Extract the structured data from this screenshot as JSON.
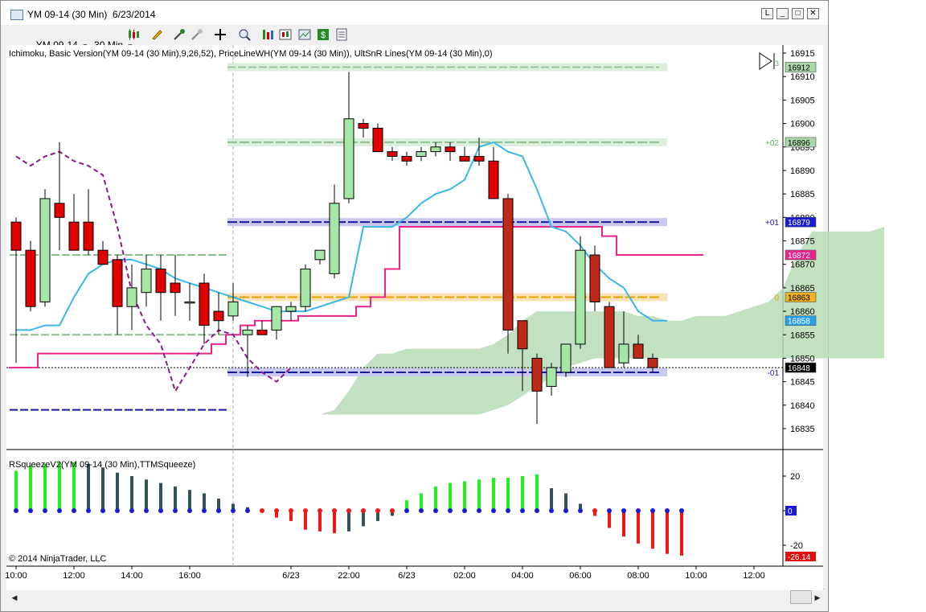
{
  "window": {
    "title": "YM 09-14 (30 Min)  6/23/2014",
    "buttons": [
      "L",
      "□",
      "✕"
    ]
  },
  "toolbar": {
    "instrument": "YM 09-14",
    "interval": "30 Min",
    "icons": [
      "candlestick-icon",
      "pencil-icon",
      "add-indicator-icon",
      "remove-indicator-icon",
      "crosshair-icon",
      "zoom-icon",
      "bar-type-icon",
      "strategy-icon",
      "chart-properties-icon",
      "dollar-icon",
      "data-box-icon"
    ]
  },
  "chart_data": [
    {
      "type": "candlestick",
      "title": "Ichimoku, Basic Version(YM 09-14 (30 Min),9,26,52), PriceLineWH(YM 09-14 (30 Min)), UltSnR Lines(YM 09-14 (30 Min),0)",
      "y_ticks": [
        16835,
        16840,
        16845,
        16850,
        16855,
        16860,
        16865,
        16870,
        16875,
        16880,
        16885,
        16890,
        16895,
        16900,
        16905,
        16910,
        16915
      ],
      "ylim": [
        16831,
        16916
      ],
      "x_ticks": [
        "10:00",
        "12:00",
        "14:00",
        "16:00",
        "6/23",
        "22:00",
        "6/23",
        "02:00",
        "04:00",
        "06:00",
        "08:00",
        "10:00",
        "12:00"
      ],
      "session_break": "6/23 18:00",
      "candles": [
        {
          "o": 16879,
          "h": 16880,
          "l": 16849,
          "c": 16873
        },
        {
          "o": 16873,
          "h": 16875,
          "l": 16860,
          "c": 16861
        },
        {
          "o": 16862,
          "h": 16886,
          "l": 16861,
          "c": 16884
        },
        {
          "o": 16883,
          "h": 16896,
          "l": 16873,
          "c": 16880
        },
        {
          "o": 16879,
          "h": 16885,
          "l": 16873,
          "c": 16873
        },
        {
          "o": 16879,
          "h": 16886,
          "l": 16872,
          "c": 16873
        },
        {
          "o": 16873,
          "h": 16875,
          "l": 16870,
          "c": 16870
        },
        {
          "o": 16871,
          "h": 16872,
          "l": 16855,
          "c": 16861
        },
        {
          "o": 16861,
          "h": 16870,
          "l": 16856,
          "c": 16865
        },
        {
          "o": 16864,
          "h": 16872,
          "l": 16861,
          "c": 16869
        },
        {
          "o": 16869,
          "h": 16872,
          "l": 16858,
          "c": 16864
        },
        {
          "o": 16866,
          "h": 16872,
          "l": 16859,
          "c": 16864
        },
        {
          "o": 16862,
          "h": 16866,
          "l": 16858,
          "c": 16862
        },
        {
          "o": 16866,
          "h": 16868,
          "l": 16853,
          "c": 16857
        },
        {
          "o": 16860,
          "h": 16864,
          "l": 16855,
          "c": 16858
        },
        {
          "o": 16859,
          "h": 16866,
          "l": 16858,
          "c": 16862
        },
        {
          "o": 16855,
          "h": 16857,
          "l": 16846,
          "c": 16856
        },
        {
          "o": 16856,
          "h": 16858,
          "l": 16855,
          "c": 16855
        },
        {
          "o": 16856,
          "h": 16861,
          "l": 16854,
          "c": 16861
        },
        {
          "o": 16860,
          "h": 16862,
          "l": 16858,
          "c": 16861
        },
        {
          "o": 16861,
          "h": 16870,
          "l": 16860,
          "c": 16869
        },
        {
          "o": 16871,
          "h": 16873,
          "l": 16870,
          "c": 16873
        },
        {
          "o": 16868,
          "h": 16887,
          "l": 16867,
          "c": 16883
        },
        {
          "o": 16884,
          "h": 16911,
          "l": 16883,
          "c": 16901
        },
        {
          "o": 16900,
          "h": 16901,
          "l": 16897,
          "c": 16899
        },
        {
          "o": 16899,
          "h": 16900,
          "l": 16895,
          "c": 16894
        },
        {
          "o": 16894,
          "h": 16895,
          "l": 16892,
          "c": 16893
        },
        {
          "o": 16893,
          "h": 16894,
          "l": 16891,
          "c": 16892
        },
        {
          "o": 16893,
          "h": 16895,
          "l": 16892,
          "c": 16894
        },
        {
          "o": 16894,
          "h": 16896,
          "l": 16893,
          "c": 16895
        },
        {
          "o": 16895,
          "h": 16896,
          "l": 16892,
          "c": 16894
        },
        {
          "o": 16893,
          "h": 16895,
          "l": 16892,
          "c": 16892
        },
        {
          "o": 16893,
          "h": 16897,
          "l": 16891,
          "c": 16892
        },
        {
          "o": 16892,
          "h": 16895,
          "l": 16884,
          "c": 16884
        },
        {
          "o": 16884,
          "h": 16885,
          "l": 16851,
          "c": 16856
        },
        {
          "o": 16858,
          "h": 16858,
          "l": 16843,
          "c": 16852
        },
        {
          "o": 16850,
          "h": 16851,
          "l": 16836,
          "c": 16843
        },
        {
          "o": 16844,
          "h": 16849,
          "l": 16842,
          "c": 16848
        },
        {
          "o": 16847,
          "h": 16853,
          "l": 16846,
          "c": 16853
        },
        {
          "o": 16853,
          "h": 16876,
          "l": 16852,
          "c": 16873
        },
        {
          "o": 16872,
          "h": 16874,
          "l": 16860,
          "c": 16862
        },
        {
          "o": 16861,
          "h": 16862,
          "l": 16848,
          "c": 16848
        },
        {
          "o": 16849,
          "h": 16860,
          "l": 16848,
          "c": 16853
        },
        {
          "o": 16853,
          "h": 16855,
          "l": 16850,
          "c": 16850
        },
        {
          "o": 16850,
          "h": 16851,
          "l": 16847,
          "c": 16848
        }
      ],
      "tenkan": [
        16856,
        16856,
        16857,
        16857,
        16863,
        16868,
        16870,
        16871,
        16871,
        16870,
        16869,
        16867,
        16866,
        16865,
        16864,
        16863,
        16862,
        16861,
        16860,
        16860,
        16860,
        16861,
        16862,
        16863,
        16878,
        16878,
        16878,
        16880,
        16883,
        16885,
        16886,
        16888,
        16895,
        16896,
        16894,
        16893,
        16886,
        16878,
        16877,
        16874,
        16870,
        16867,
        16865,
        16860,
        16858,
        16858
      ],
      "kijun": [
        16848,
        16848,
        16851,
        16851,
        16851,
        16851,
        16851,
        16851,
        16851,
        16851,
        16851,
        16851,
        16851,
        16851,
        16853,
        16855,
        16857,
        16858,
        16858,
        16858,
        16859,
        16859,
        16859,
        16859,
        16861,
        16863,
        16869,
        16878,
        16878,
        16878,
        16878,
        16878,
        16878,
        16878,
        16878,
        16878,
        16878,
        16878,
        16878,
        16878,
        16878,
        16876,
        16872,
        16872,
        16872,
        16872,
        16872,
        16872
      ],
      "chikou": [
        16893,
        16891,
        16893,
        16894,
        16892,
        16891,
        16889,
        16878,
        16864,
        16857,
        16853,
        16843,
        16848,
        16853,
        16856,
        16855,
        16850,
        16847,
        16845,
        16848
      ],
      "cloud": {
        "x_start_index": 18,
        "top": [
          16838,
          16838,
          16838,
          16838,
          16839,
          16843,
          16848,
          16851,
          16851,
          16852,
          16852,
          16852,
          16852,
          16852,
          16852,
          16853,
          16855,
          16858,
          16860,
          16860,
          16860,
          16860,
          16860,
          16860,
          16860,
          16859,
          16859,
          16858,
          16858,
          16859,
          16859,
          16859,
          16860,
          16861,
          16862,
          16865,
          16872,
          16877,
          16877,
          16877,
          16877,
          16877,
          16878
        ],
        "bottom": [
          16838,
          16838,
          16838,
          16838,
          16838,
          16838,
          16838,
          16838,
          16838,
          16838,
          16838,
          16838,
          16838,
          16838,
          16838,
          16839,
          16840,
          16842,
          16844,
          16846,
          16848,
          16849,
          16850,
          16850,
          16850,
          16850,
          16850,
          16850,
          16850,
          16850,
          16850,
          16850,
          16850,
          16850,
          16850,
          16850,
          16850,
          16850,
          16850,
          16850,
          16850,
          16850,
          16850
        ]
      },
      "levels_prior": [
        {
          "name": "resistance",
          "value": 16872,
          "color": "#8fbc8f",
          "dashed": true
        },
        {
          "name": "support",
          "value": 16855,
          "color": "#8fbc8f",
          "dashed": true
        },
        {
          "name": "s2",
          "value": 16839,
          "color": "#1a1aa0",
          "dashed": true
        }
      ],
      "levels_current": [
        {
          "label": "+02",
          "value": 16896,
          "color": "#8fbc8f",
          "badge": "16896",
          "text_color": "#66aa66"
        },
        {
          "label": "+01",
          "value": 16879,
          "color": "#1a1aa0",
          "badge": "16879",
          "text_color": "#1a1aa0"
        },
        {
          "label": "0",
          "value": 16863,
          "color": "#e8a000",
          "badge": "16863",
          "text_color": "#e8a000"
        },
        {
          "label": "-01",
          "value": 16847,
          "color": "#1a1aa0",
          "badge": "16848",
          "text_color": "#1a1aa0"
        }
      ],
      "top_level": {
        "label": "+3",
        "value": 16912,
        "badge": "16912"
      },
      "axis_badges": [
        {
          "value": 16912,
          "text": "16912",
          "bg": "#a8d8a8",
          "fg": "#000"
        },
        {
          "value": 16896,
          "text": "16896",
          "bg": "#a8d8a8",
          "fg": "#000"
        },
        {
          "value": 16879,
          "text": "16879",
          "bg": "#1a1ad0",
          "fg": "#fff"
        },
        {
          "value": 16872,
          "text": "16872",
          "bg": "#e8268a",
          "fg": "#fff"
        },
        {
          "value": 16863,
          "text": "16863",
          "bg": "#f0b020",
          "fg": "#000"
        },
        {
          "value": 16858,
          "text": "16858",
          "bg": "#2aa0e8",
          "fg": "#fff"
        },
        {
          "value": 16848,
          "text": "16848",
          "bg": "#000000",
          "fg": "#fff"
        }
      ],
      "last_price": 16848
    },
    {
      "type": "bar",
      "title": "RSqueezeV2(YM 09-14 (30 Min),TTMSqueeze)",
      "y_ticks": [
        20,
        0,
        -20
      ],
      "ylim": [
        -28,
        28
      ],
      "current_badge": "0",
      "last_value_badge": "-26.14",
      "values": [
        23,
        26,
        27,
        28,
        28,
        27,
        25,
        22,
        20,
        18,
        16,
        14,
        12,
        10,
        7,
        4,
        2,
        0,
        -4,
        -6,
        -11,
        -12,
        -13,
        -12,
        -9,
        -6,
        -3,
        6,
        10,
        14,
        16,
        17,
        18,
        19,
        19,
        20,
        21,
        13,
        10,
        4,
        -3,
        -10,
        -15,
        -19,
        -22,
        -25,
        -26
      ],
      "dot_colors": [
        "blue",
        "blue",
        "blue",
        "blue",
        "blue",
        "blue",
        "blue",
        "blue",
        "blue",
        "blue",
        "blue",
        "blue",
        "blue",
        "blue",
        "blue",
        "blue",
        "blue",
        "red",
        "red",
        "red",
        "red",
        "red",
        "red",
        "red",
        "red",
        "red",
        "red",
        "blue",
        "blue",
        "blue",
        "blue",
        "blue",
        "blue",
        "blue",
        "blue",
        "blue",
        "blue",
        "blue",
        "blue",
        "blue",
        "red",
        "blue",
        "blue",
        "blue",
        "blue",
        "blue",
        "blue"
      ]
    }
  ],
  "copyright": "© 2014 NinjaTrader, LLC"
}
